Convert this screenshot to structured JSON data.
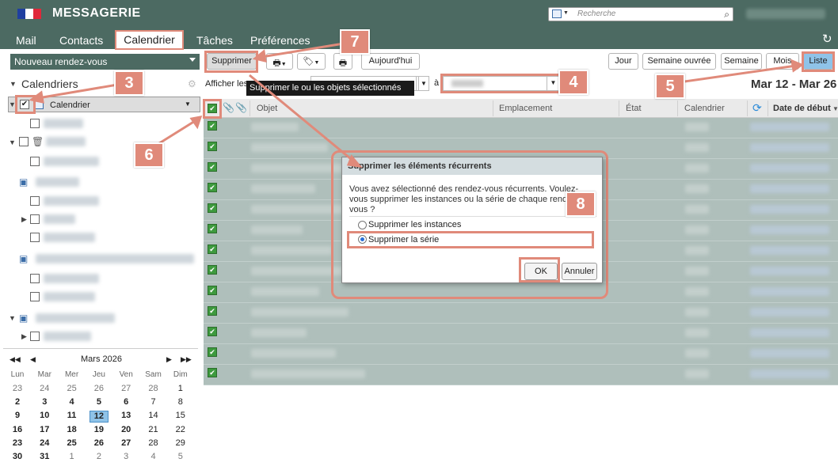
{
  "app": {
    "title": "MESSAGERIE"
  },
  "search": {
    "placeholder": "Recherche"
  },
  "nav": {
    "tabs": [
      "Mail",
      "Contacts",
      "Calendrier",
      "Tâches",
      "Préférences"
    ],
    "active": "Calendrier"
  },
  "toolbar": {
    "new_label": "Nouveau rendez-vous",
    "delete_label": "Supprimer",
    "today_label": "Aujourd'hui",
    "views": [
      "Jour",
      "Semaine ouvrée",
      "Semaine",
      "Mois",
      "Liste"
    ],
    "active_view": "Liste"
  },
  "filter": {
    "label": "Afficher les",
    "to_label": "à"
  },
  "date_range": "Mar 12 - Mar 26",
  "tooltip": "Supprimer le ou les objets sélectionnés",
  "sidebar": {
    "title": "Calendriers",
    "calendar_label": "Calendrier"
  },
  "grid": {
    "columns": [
      "Objet",
      "Emplacement",
      "État",
      "Calendrier",
      "Date de début"
    ]
  },
  "mini_calendar": {
    "month": "Mars 2026",
    "weekdays": [
      "Lun",
      "Mar",
      "Mer",
      "Jeu",
      "Ven",
      "Sam",
      "Dim"
    ],
    "weeks": [
      [
        "23",
        "24",
        "25",
        "26",
        "27",
        "28",
        "1"
      ],
      [
        "2",
        "3",
        "4",
        "5",
        "6",
        "7",
        "8"
      ],
      [
        "9",
        "10",
        "11",
        "12",
        "13",
        "14",
        "15"
      ],
      [
        "16",
        "17",
        "18",
        "19",
        "20",
        "21",
        "22"
      ],
      [
        "23",
        "24",
        "25",
        "26",
        "27",
        "28",
        "29"
      ],
      [
        "30",
        "31",
        "1",
        "2",
        "3",
        "4",
        "5"
      ]
    ],
    "today": "12"
  },
  "dialog": {
    "title": "Supprimer les éléments récurrents",
    "message": "Vous avez sélectionné des rendez-vous récurrents. Voulez-vous supprimer les instances ou la série de chaque rendez-vous ?",
    "option_instances": "Supprimer les instances",
    "option_series": "Supprimer la série",
    "ok_label": "OK",
    "cancel_label": "Annuler"
  },
  "callouts": [
    "3",
    "4",
    "5",
    "6",
    "7",
    "8"
  ],
  "colors": {
    "header": "#4c6a62",
    "accent": "#e08a7a",
    "grid_selected": "#afbfbb",
    "active_view": "#8fc3e8"
  }
}
